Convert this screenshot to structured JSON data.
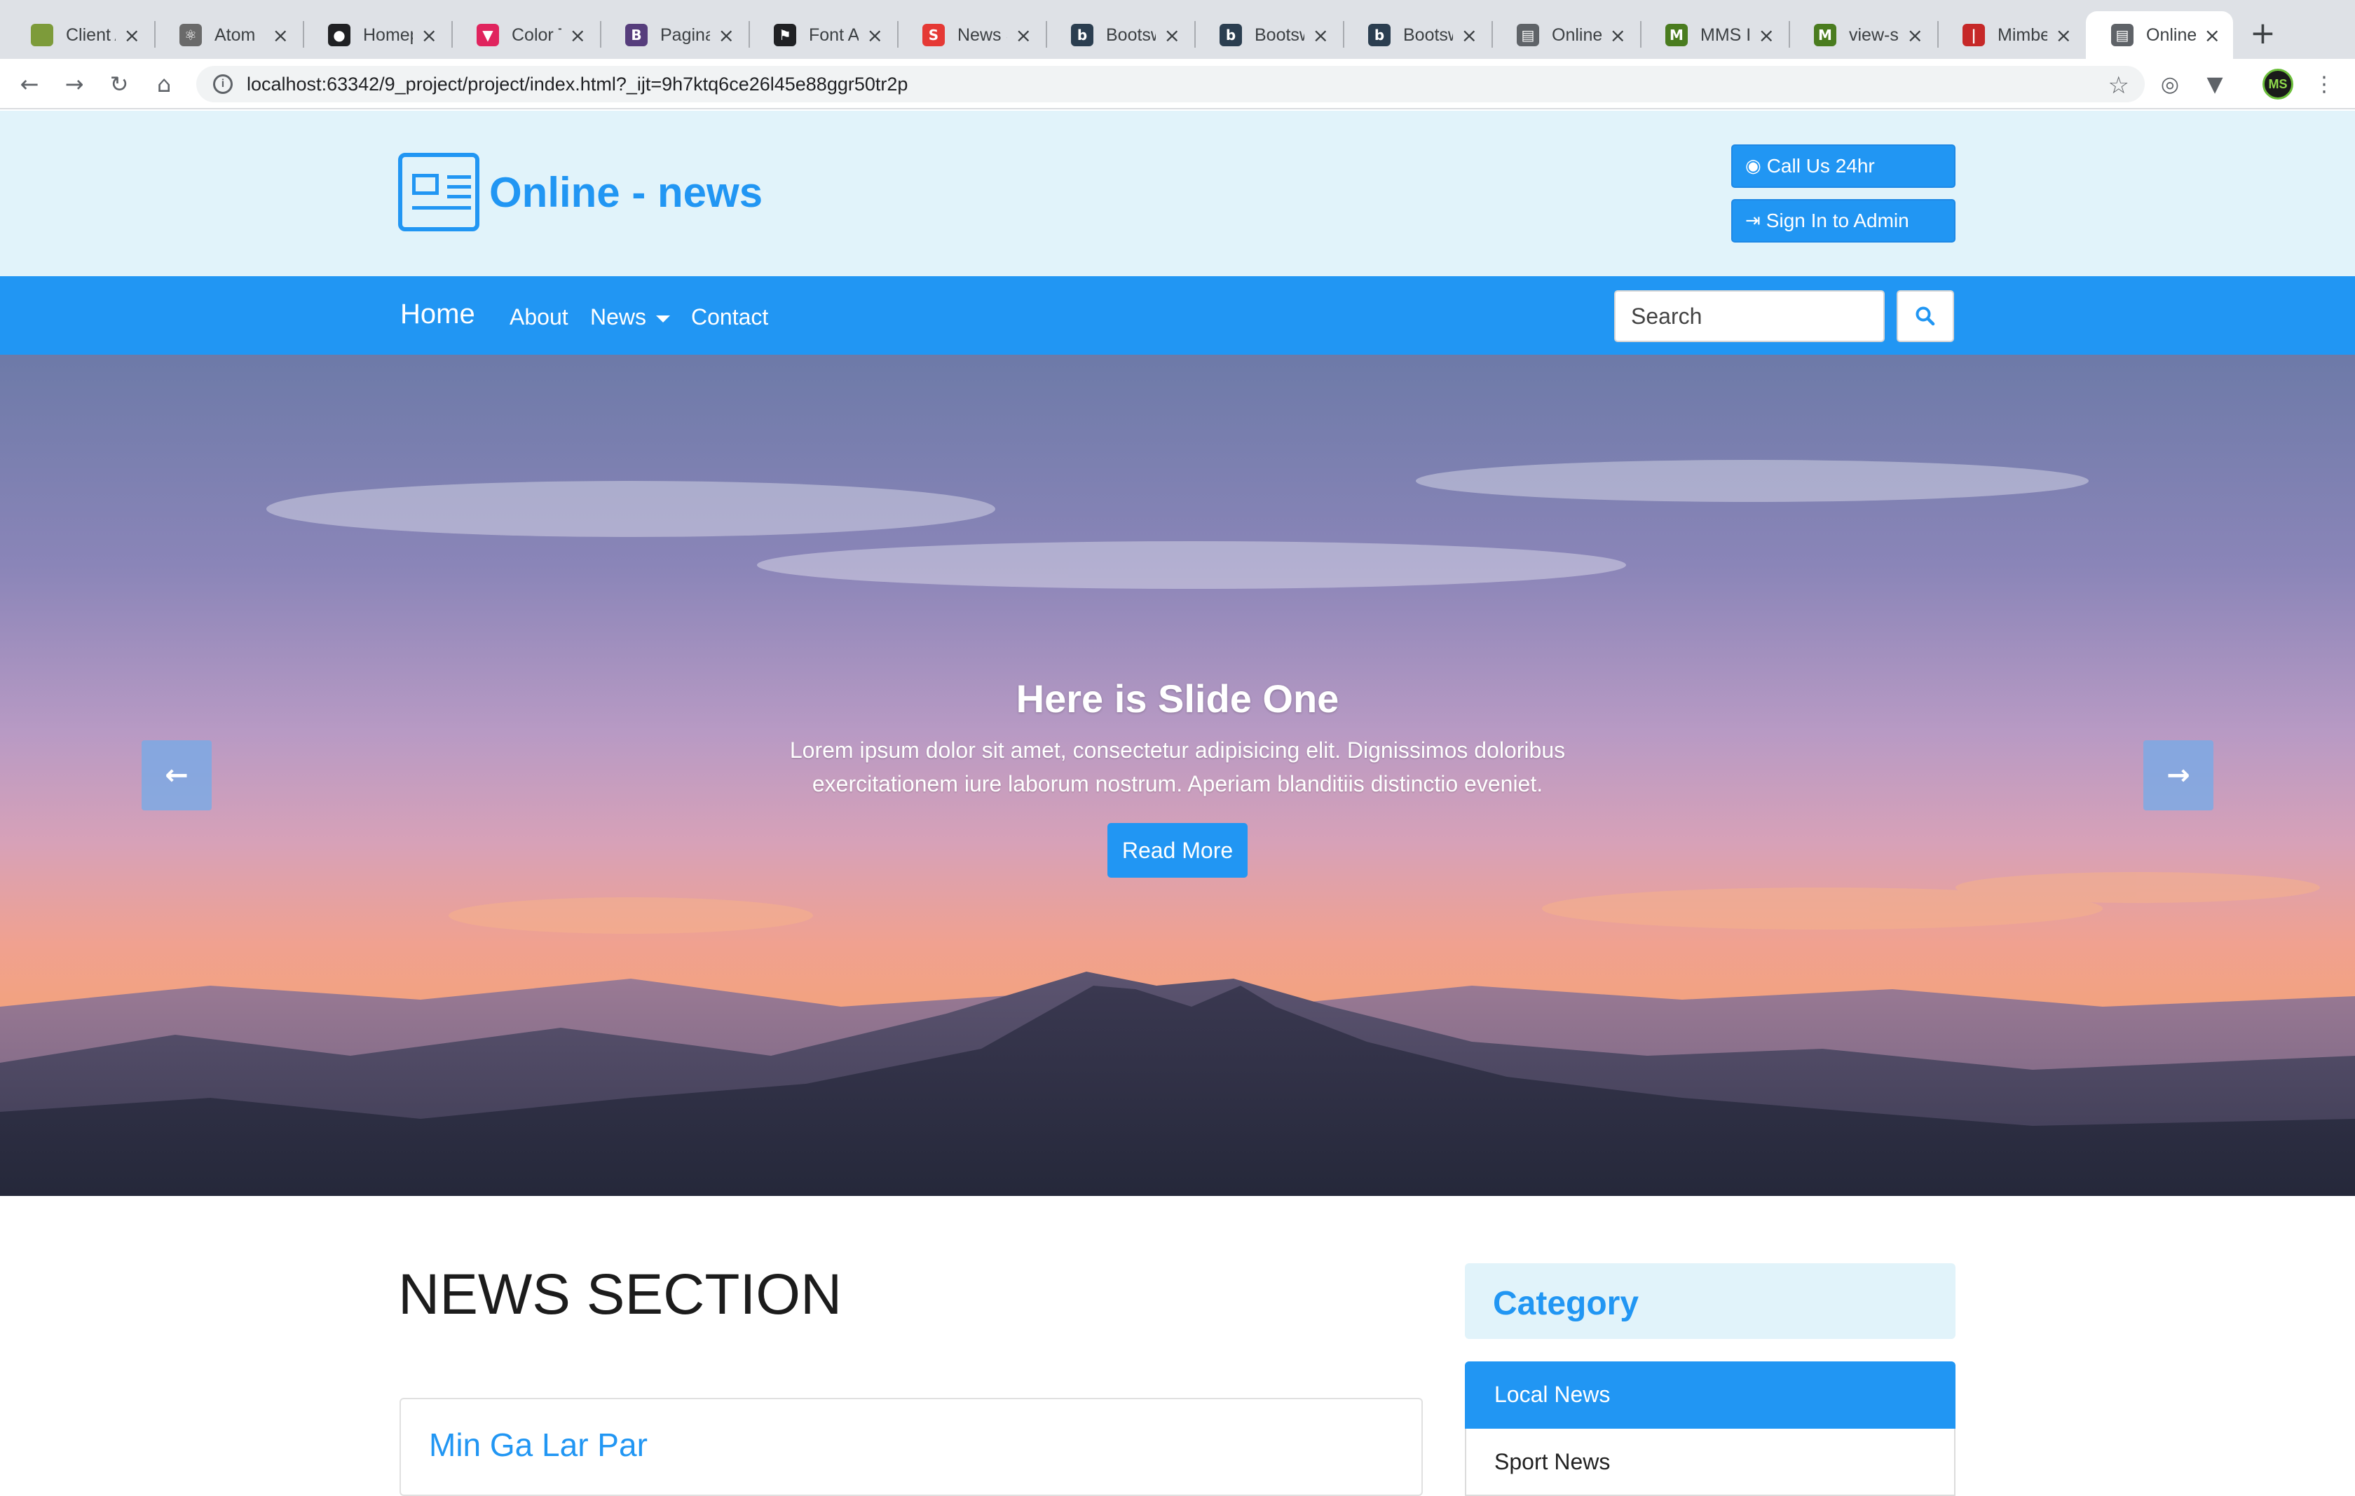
{
  "browser": {
    "tabs": [
      {
        "label": "Client A",
        "icon": "tree-icon",
        "color": "#7d9b3a",
        "glyph": ""
      },
      {
        "label": "Atom",
        "icon": "atom-icon",
        "color": "#6a6a6a",
        "glyph": "⚛"
      },
      {
        "label": "Homepage",
        "icon": "github-icon",
        "color": "#202124",
        "glyph": "●"
      },
      {
        "label": "Color Tool",
        "icon": "color-tool-icon",
        "color": "#e0245e",
        "glyph": "▼"
      },
      {
        "label": "Pagination",
        "icon": "bootstrap-icon",
        "color": "#563d7c",
        "glyph": "B"
      },
      {
        "label": "Font Awesome",
        "icon": "flag-icon",
        "color": "#202124",
        "glyph": "⚑"
      },
      {
        "label": "News Site",
        "icon": "news-site-icon",
        "color": "#e53935",
        "glyph": "S"
      },
      {
        "label": "Bootswatch",
        "icon": "bootswatch-icon",
        "color": "#2b3e50",
        "glyph": "b"
      },
      {
        "label": "Bootswatch",
        "icon": "bootswatch-icon",
        "color": "#2b3e50",
        "glyph": "b"
      },
      {
        "label": "Bootswatch",
        "icon": "bootswatch-icon",
        "color": "#2b3e50",
        "glyph": "b"
      },
      {
        "label": "Online News",
        "icon": "newspaper-icon",
        "color": "#5f6368",
        "glyph": "▤"
      },
      {
        "label": "MMS IT",
        "icon": "mms-icon",
        "color": "#4a7c1f",
        "glyph": "M"
      },
      {
        "label": "view-source",
        "icon": "mms-icon",
        "color": "#4a7c1f",
        "glyph": "M"
      },
      {
        "label": "Mimber",
        "icon": "mimber-icon",
        "color": "#c62828",
        "glyph": "|"
      },
      {
        "label": "Online News",
        "icon": "newspaper-icon",
        "color": "#5f6368",
        "glyph": "▤"
      }
    ],
    "url": "localhost:63342/9_project/project/index.html?_ijt=9h7ktq6ce26l45e88ggr50tr2p"
  },
  "header": {
    "brand": "Online - news",
    "call_label": "Call Us 24hr",
    "signin_label": "Sign In to Admin"
  },
  "nav": {
    "home": "Home",
    "about": "About",
    "news": "News",
    "contact": "Contact",
    "search_placeholder": "Search"
  },
  "hero": {
    "title": "Here is Slide One",
    "text": "Lorem ipsum dolor sit amet, consectetur adipisicing elit. Dignissimos doloribus exercitationem iure laborum nostrum. Aperiam blanditiis distinctio eveniet.",
    "button": "Read More"
  },
  "main": {
    "section_title": "NEWS SECTION",
    "first_news_title": "Min Ga Lar Par"
  },
  "sidebar": {
    "heading": "Category",
    "items": [
      "Local News",
      "Sport News"
    ]
  },
  "colors": {
    "primary": "#2196f3",
    "header_bg": "#e1f3fa"
  }
}
